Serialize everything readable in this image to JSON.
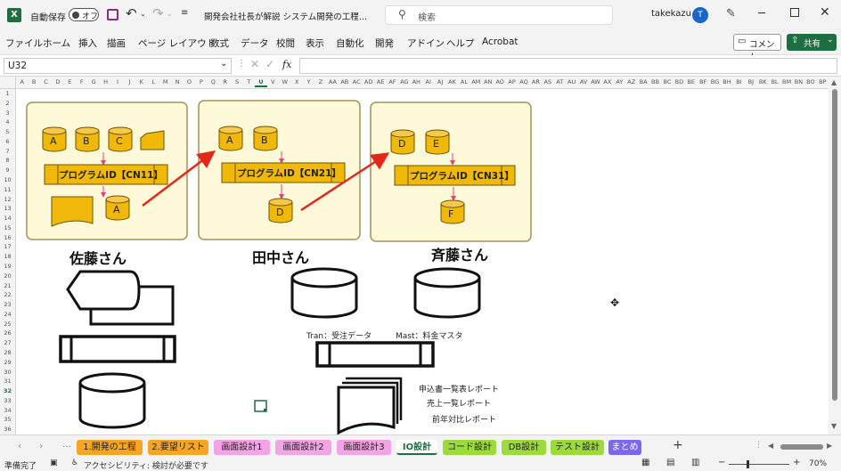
{
  "window": {
    "autosave_label": "自動保存",
    "autosave_state": "オフ",
    "doc_title": "開発会社社長が解説 システム開発の工程…",
    "search_placeholder": "検索",
    "user_name": "takekazu",
    "user_initial": "T"
  },
  "menu": [
    "ファイル",
    "ホーム",
    "挿入",
    "描画",
    "ページ レイアウト",
    "数式",
    "データ",
    "校閲",
    "表示",
    "自動化",
    "開発",
    "アドイン",
    "ヘルプ",
    "Acrobat"
  ],
  "ribbon_buttons": {
    "comment": "コメント",
    "share": "共有"
  },
  "formula": {
    "name_box": "U32",
    "fx": "fx",
    "value": ""
  },
  "columns": [
    "A",
    "B",
    "C",
    "D",
    "E",
    "F",
    "G",
    "H",
    "I",
    "J",
    "K",
    "L",
    "M",
    "N",
    "O",
    "P",
    "Q",
    "R",
    "S",
    "T",
    "U",
    "V",
    "W",
    "X",
    "Y",
    "Z",
    "AA",
    "AB",
    "AC",
    "AD",
    "AE",
    "AF",
    "AG",
    "AH",
    "AI",
    "AJ",
    "AK",
    "AL",
    "AM",
    "AN",
    "AO",
    "AP",
    "AQ",
    "AR",
    "AS",
    "AT",
    "AU",
    "AV",
    "AW",
    "AX",
    "AY",
    "AZ",
    "BA",
    "BB",
    "BC",
    "BD",
    "BE",
    "BF",
    "BG",
    "BH",
    "BI",
    "BJ",
    "BK",
    "BL",
    "BM",
    "BN",
    "BO",
    "BP"
  ],
  "rows": [
    "1",
    "2",
    "3",
    "4",
    "5",
    "6",
    "7",
    "8",
    "9",
    "10",
    "11",
    "12",
    "13",
    "14",
    "15",
    "16",
    "17",
    "18",
    "19",
    "20",
    "21",
    "22",
    "23",
    "24",
    "25",
    "26",
    "27",
    "28",
    "29",
    "30",
    "31",
    "32",
    "33",
    "34",
    "35",
    "36"
  ],
  "diagram": {
    "box1": {
      "inputs": [
        "A",
        "B",
        "C"
      ],
      "program": "プログラムID【CN11】",
      "output": "A"
    },
    "box2": {
      "inputs": [
        "A",
        "B"
      ],
      "program": "プログラムID【CN21】",
      "output": "D"
    },
    "box3": {
      "inputs": [
        "D",
        "E"
      ],
      "program": "プログラムID【CN31】",
      "output": "F"
    },
    "persons": [
      "佐藤さん",
      "田中さん",
      "斉藤さん"
    ],
    "tran_label": "Tran：受注データ",
    "mast_label": "Mast：料金マスタ",
    "reports": [
      "申込書一覧表レポート",
      "売上一覧レポート",
      "前年対比レポート"
    ],
    "colors": {
      "cylinder": "#f0b90a",
      "box_bg": "#fdf9d9",
      "box_border": "#a4925a",
      "arrow": "#e3281b",
      "link": "#e0447a"
    }
  },
  "sheets": [
    {
      "label": "1.開発の工程",
      "color": "#f6a623"
    },
    {
      "label": "2.要望リスト",
      "color": "#f6a623"
    },
    {
      "label": "画面設計1",
      "color": "#f4a3e6"
    },
    {
      "label": "画面設計2",
      "color": "#f4a3e6"
    },
    {
      "label": "画面設計3",
      "color": "#f4a3e6"
    },
    {
      "label": "IO設計",
      "color": "#ffffff"
    },
    {
      "label": "コード設計",
      "color": "#9bdc3c"
    },
    {
      "label": "DB設計",
      "color": "#9bdc3c"
    },
    {
      "label": "テスト設計",
      "color": "#9bdc3c"
    },
    {
      "label": "まとめ",
      "color": "#7b68ee"
    }
  ],
  "status": {
    "ready": "準備完了",
    "accessibility": "アクセシビリティ: 検討が必要です",
    "zoom": "70%"
  }
}
